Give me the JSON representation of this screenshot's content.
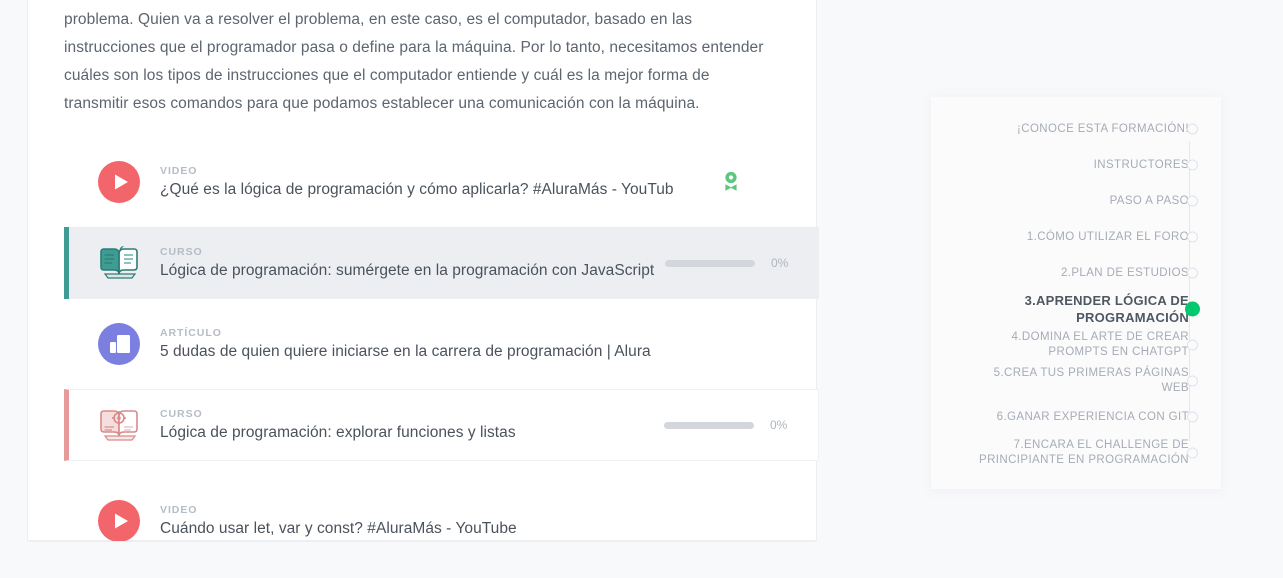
{
  "main": {
    "paragraph": "problema. Quien va a resolver el problema, en este caso, es el computador, basado en las instrucciones que el programador pasa o define para la máquina. Por lo tanto, necesitamos entender cuáles son los tipos de instrucciones que el computador entiende y cuál es la mejor forma de transmitir esos comandos para que podamos establecer una comunicación con la máquina.",
    "items": [
      {
        "kicker": "VIDEO",
        "title": "¿Qué es la lógica de programación y cómo aplicarla? #AluraMás - YouTub",
        "icon": "play-circle-icon",
        "style": "plain",
        "badge": "award-badge-icon"
      },
      {
        "kicker": "CURSO",
        "title": "Lógica de programación: sumérgete en la programación con JavaScript",
        "icon": "book-teal-icon",
        "style": "card-teal",
        "progress": "0%",
        "accent": "#3f9c93"
      },
      {
        "kicker": "ARTÍCULO",
        "title": "5 dudas de quien quiere iniciarse en la carrera de programación | Alura",
        "icon": "article-circle-icon",
        "style": "plain"
      },
      {
        "kicker": "CURSO",
        "title": "Lógica de programación: explorar funciones y listas",
        "icon": "book-pink-icon",
        "style": "card-pink",
        "progress": "0%",
        "accent": "#e69a9a"
      },
      {
        "kicker": "VIDEO",
        "title": "Cuándo usar let, var y const? #AluraMás - YouTube",
        "icon": "play-circle-icon",
        "style": "plain"
      }
    ]
  },
  "sidebar": {
    "items": [
      {
        "label": "¡CONOCE ESTA FORMACIÓN!",
        "active": false
      },
      {
        "label": "INSTRUCTORES",
        "active": false
      },
      {
        "label": "PASO A PASO",
        "active": false
      },
      {
        "label": "1.CÓMO UTILIZAR EL FORO",
        "active": false
      },
      {
        "label": "2.PLAN DE ESTUDIOS",
        "active": false
      },
      {
        "label": "3.APRENDER LÓGICA DE PROGRAMACIÓN",
        "active": true
      },
      {
        "label": "4.DOMINA EL ARTE DE CREAR PROMPTS EN CHATGPT",
        "active": false
      },
      {
        "label": "5.CREA TUS PRIMERAS PÁGINAS WEB",
        "active": false
      },
      {
        "label": "6.GANAR EXPERIENCIA CON GIT",
        "active": false
      },
      {
        "label": "7.ENCARA EL CHALLENGE DE PRINCIPIANTE EN PROGRAMACIÓN",
        "active": false
      }
    ]
  },
  "colors": {
    "video_red": "#f2656a",
    "course_teal": "#3f9c93",
    "course_pink": "#e69a9a",
    "article_purple": "#7a7fe0",
    "badge_green": "#5ec77f",
    "active_green": "#00c86f",
    "page_bg": "#f8f9fb",
    "panel_bg": "#ffffff",
    "card_bg": "#eceef2"
  }
}
